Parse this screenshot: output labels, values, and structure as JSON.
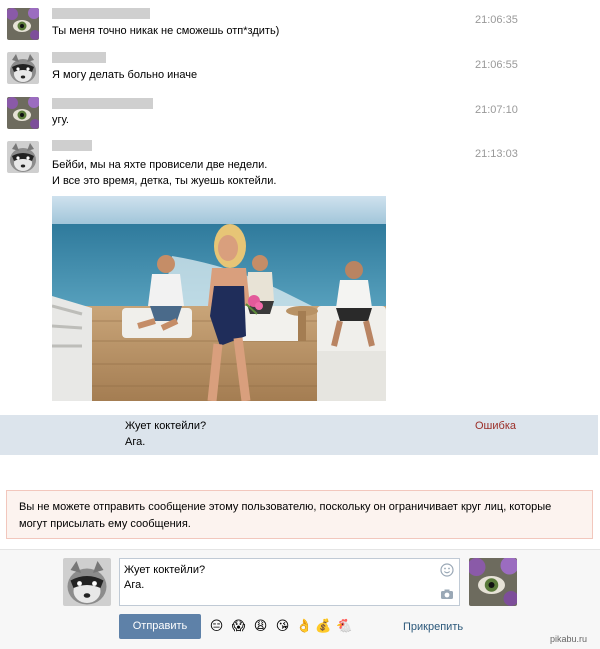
{
  "messages": [
    {
      "time": "21:06:35",
      "text": "Ты меня точно никак не сможешь отп*здить)"
    },
    {
      "time": "21:06:55",
      "text": "Я могу делать больно иначе"
    },
    {
      "time": "21:07:10",
      "text": "угу."
    },
    {
      "time": "21:13:03",
      "text_line1": "Бейби, мы на яхте провисели две недели.",
      "text_line2": "И все это время, детка, ты жуешь коктейли."
    }
  ],
  "failed_message": {
    "line1": "Жует коктейли?",
    "line2": "Ага.",
    "status": "Ошибка"
  },
  "alert": {
    "text": "Вы не можете отправить сообщение этому пользователю, поскольку он ограничивает круг лиц, которые могут присылать ему сообщения."
  },
  "composer": {
    "line1": "Жует коктейли?",
    "line2": "Ага.",
    "send_label": "Отправить",
    "attach_label": "Прикрепить",
    "emojis": [
      "😑",
      "😱",
      "😩",
      "😘",
      "👌",
      "💰",
      "🐔"
    ]
  },
  "watermark": "pikabu.ru"
}
